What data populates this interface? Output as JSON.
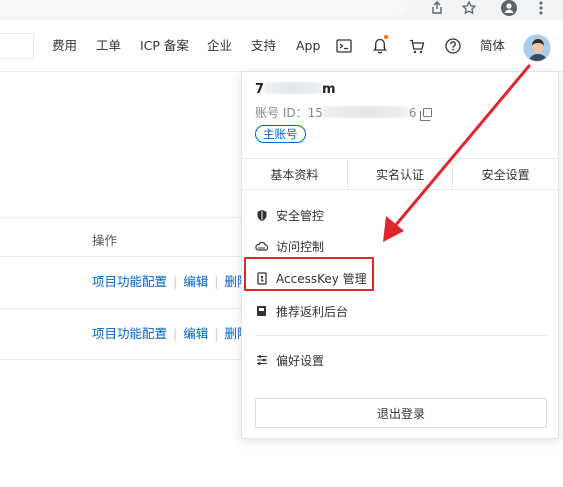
{
  "browser": {
    "icons": [
      "share-icon",
      "star-icon",
      "profile-icon",
      "more-vert-icon"
    ]
  },
  "topnav": {
    "items": [
      {
        "label": "费用"
      },
      {
        "label": "工单"
      },
      {
        "label": "ICP 备案"
      },
      {
        "label": "企业"
      },
      {
        "label": "支持"
      },
      {
        "label": "App"
      }
    ],
    "icons": [
      "terminal-icon",
      "bell-icon",
      "cart-icon",
      "help-icon"
    ],
    "lang_label": "简体",
    "accent_color": "#ff6a00"
  },
  "table": {
    "op_header": "操作",
    "rows": [
      {
        "config": "项目功能配置",
        "edit": "编辑",
        "delete": "删除"
      },
      {
        "config": "项目功能配置",
        "edit": "编辑",
        "delete": "删除"
      }
    ]
  },
  "account_menu": {
    "name_prefix": "7",
    "name_suffix": "m",
    "account_id_label": "账号 ID：15",
    "account_id_suffix": "6",
    "badge": "主账号",
    "tabs": [
      {
        "label": "基本资料"
      },
      {
        "label": "实名认证"
      },
      {
        "label": "安全设置"
      }
    ],
    "items": [
      {
        "label": "安全管控",
        "icon": "shield-icon"
      },
      {
        "label": "访问控制",
        "icon": "cloud-icon"
      },
      {
        "label": "AccessKey 管理",
        "icon": "key-card-icon"
      },
      {
        "label": "推荐返利后台",
        "icon": "gift-box-icon"
      },
      {
        "label": "偏好设置",
        "icon": "sliders-icon"
      }
    ],
    "logout_label": "退出登录"
  },
  "annotation": {
    "color": "#e0262c"
  }
}
